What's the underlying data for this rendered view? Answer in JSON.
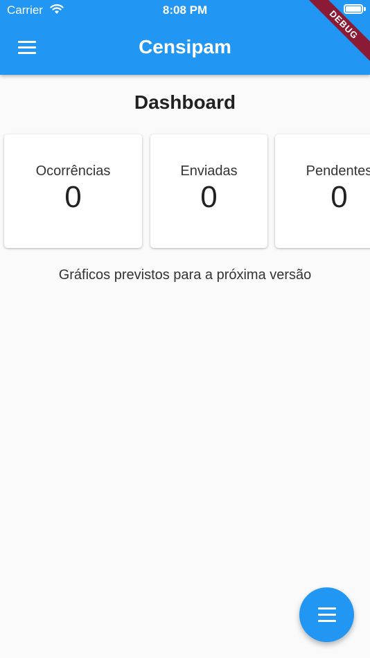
{
  "status_bar": {
    "carrier": "Carrier",
    "time": "8:08 PM"
  },
  "app_bar": {
    "title": "Censipam",
    "menu_icon": "hamburger-menu-icon"
  },
  "debug_banner": "DEBUG",
  "dashboard": {
    "heading": "Dashboard",
    "cards": [
      {
        "label": "Ocorrências",
        "value": "0"
      },
      {
        "label": "Enviadas",
        "value": "0"
      },
      {
        "label": "Pendentes",
        "value": "0"
      }
    ],
    "note": "Gráficos previstos para a próxima versão"
  },
  "fab": {
    "icon": "hamburger-menu-icon"
  },
  "colors": {
    "primary": "#2196f3",
    "background": "#fafafa",
    "debug_ribbon": "#8b1a34"
  }
}
